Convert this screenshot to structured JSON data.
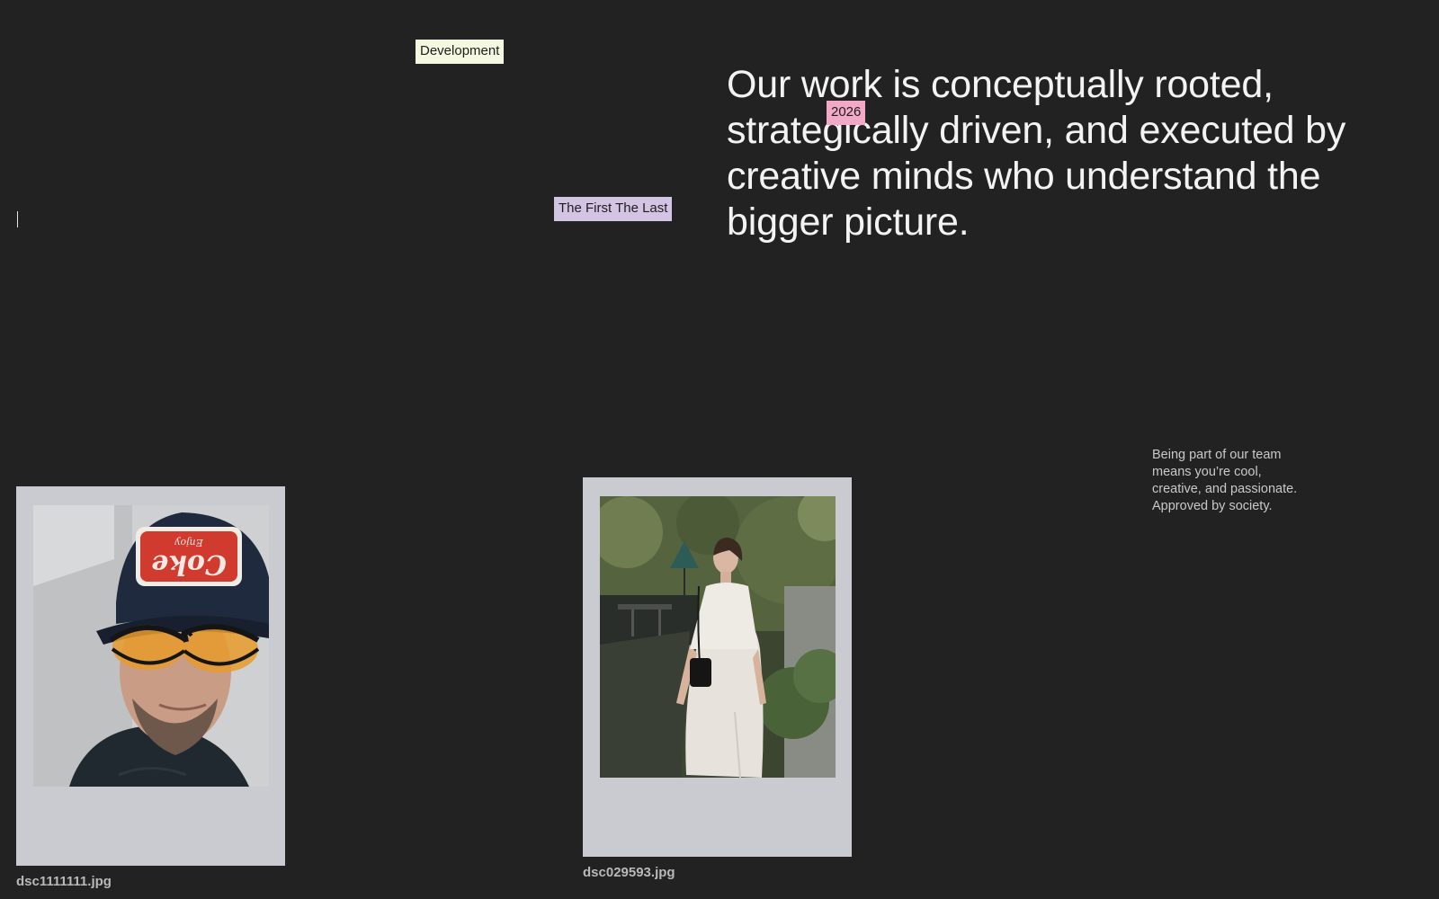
{
  "tags": {
    "development": "Development",
    "year": "2026",
    "project": "The First The Last"
  },
  "headline": "Our work is conceptually rooted, strategically driven, and executed by creative minds who understand the bigger picture.",
  "blurb": {
    "lines": [
      "Being part of our team",
      "means you’re cool,",
      "creative, and passionate.",
      "Approved by society."
    ]
  },
  "photos": [
    {
      "filename": "dsc1111111.jpg",
      "cap_text": "Enjoy",
      "cap_brand": "Coke"
    },
    {
      "filename": "dsc029593.jpg"
    }
  ],
  "colors": {
    "background": "#222222",
    "tag_development": "#f4f8e0",
    "tag_year": "#f2a9c8",
    "tag_project": "#d3c4e4",
    "polaroid_frame": "#c9cbd0",
    "headline_text": "#f3f3f3"
  }
}
